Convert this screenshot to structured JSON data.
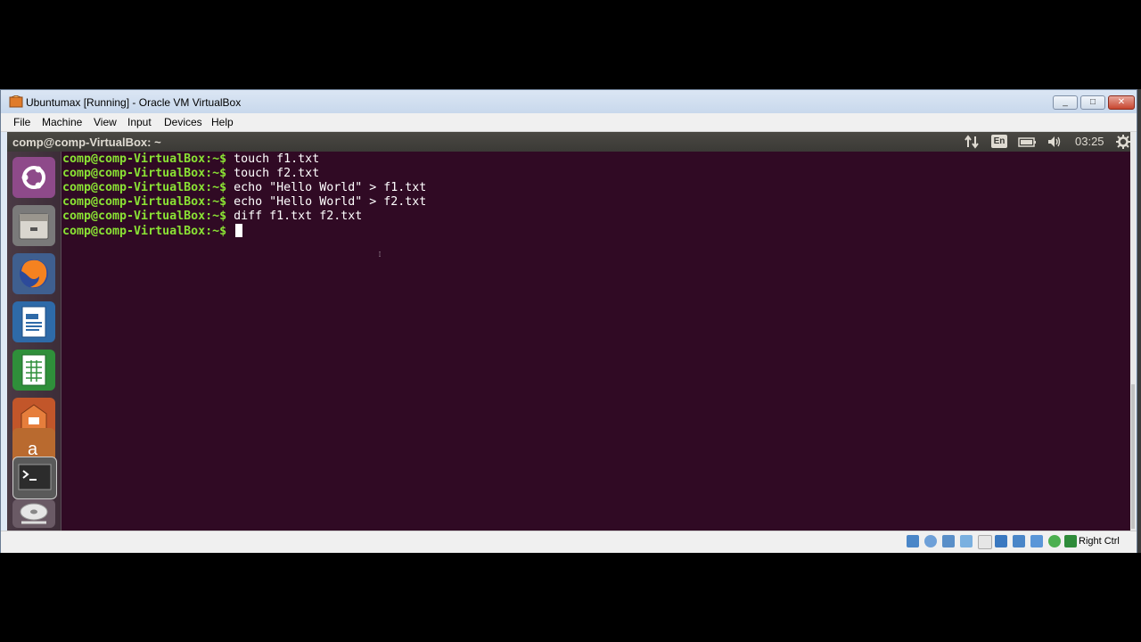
{
  "window": {
    "title": "Ubuntumax [Running] - Oracle VM VirtualBox",
    "controls": {
      "minimize": "_",
      "maximize": "□",
      "close": "✕"
    }
  },
  "menubar": {
    "items": [
      "File",
      "Machine",
      "View",
      "Input",
      "Devices",
      "Help"
    ]
  },
  "ubuntu_panel": {
    "title": "comp@comp-VirtualBox: ~",
    "keyboard_layout": "En",
    "clock": "03:25",
    "icons": [
      "network-arrows-icon",
      "keyboard-layout-icon",
      "battery-icon",
      "volume-icon",
      "gear-icon"
    ]
  },
  "launcher": {
    "items": [
      "ubuntu-dash-icon",
      "files-icon",
      "firefox-icon",
      "writer-icon",
      "calc-icon",
      "software-center-icon",
      "amazon-icon",
      "terminal-icon",
      "dvd-icon"
    ]
  },
  "terminal": {
    "prompt": "comp@comp-VirtualBox:~$",
    "lines": [
      {
        "prompt": "comp@comp-VirtualBox:~$",
        "command": " touch f1.txt"
      },
      {
        "prompt": "comp@comp-VirtualBox:~$",
        "command": " touch f2.txt"
      },
      {
        "prompt": "comp@comp-VirtualBox:~$",
        "command": " echo \"Hello World\" > f1.txt"
      },
      {
        "prompt": "comp@comp-VirtualBox:~$",
        "command": " echo \"Hello World\" > f2.txt"
      },
      {
        "prompt": "comp@comp-VirtualBox:~$",
        "command": " diff f1.txt f2.txt"
      },
      {
        "prompt": "comp@comp-VirtualBox:~$",
        "command": " "
      }
    ]
  },
  "statusbar": {
    "host_key": "Right Ctrl",
    "icons": [
      "hard-disk-icon",
      "optical-drive-icon",
      "audio-icon",
      "network-icon",
      "usb-icon",
      "shared-folders-icon",
      "display-icon",
      "video-capture-icon",
      "cpu-icon",
      "mouse-integration-icon",
      "guest-additions-icon"
    ]
  },
  "colors": {
    "terminal_bg": "#300a24",
    "prompt": "#8ae234",
    "panel": "#3b3a36"
  }
}
